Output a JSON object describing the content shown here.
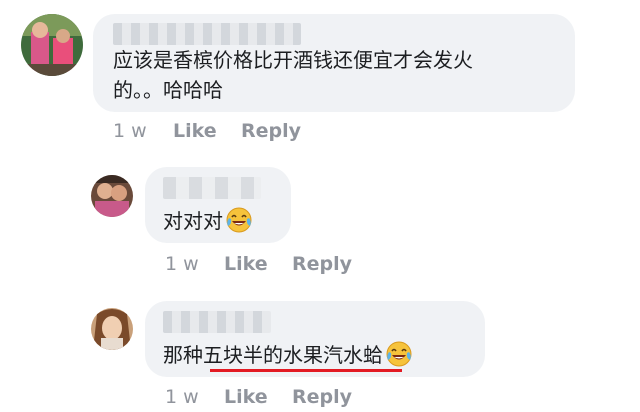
{
  "comments": [
    {
      "id": "comment-1",
      "text_line1": "应该是香槟价格比开酒钱还便宜才会发火",
      "text_line2": "的。。哈哈哈",
      "time": "1 w",
      "like_label": "Like",
      "reply_label": "Reply"
    },
    {
      "id": "comment-2",
      "text": "对对对",
      "emoji": "face-with-tears-of-joy-icon",
      "time": "1 w",
      "like_label": "Like",
      "reply_label": "Reply"
    },
    {
      "id": "comment-3",
      "text_plain": "那种",
      "text_underlined": "五块半的水果汽水",
      "text_after": "蛤",
      "emoji": "face-with-tears-of-joy-icon",
      "time": "1 w",
      "like_label": "Like",
      "reply_label": "Reply"
    }
  ],
  "colors": {
    "bubble": "#f0f2f5",
    "text": "#1c1e21",
    "meta": "#90949c",
    "annotation": "#e31b23"
  }
}
